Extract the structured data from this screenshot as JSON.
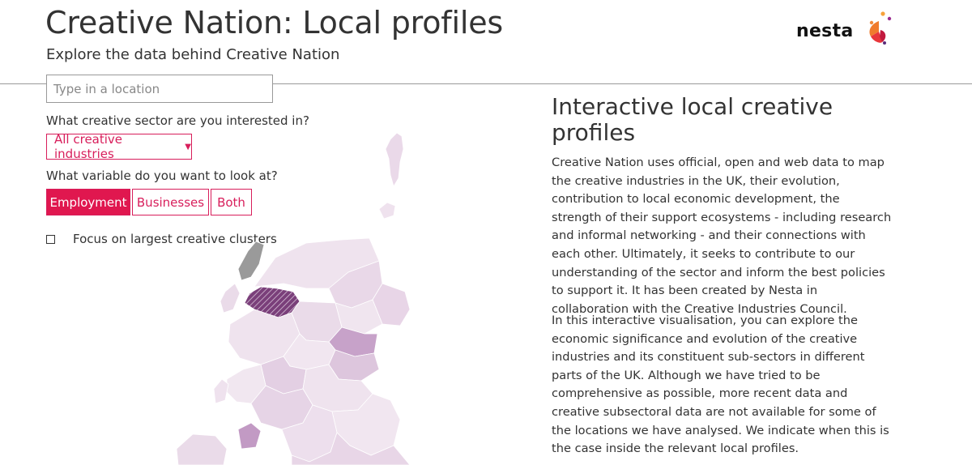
{
  "header": {
    "title": "Creative Nation: Local profiles",
    "subtitle": "Explore the data behind Creative Nation",
    "logo_text": "nesta"
  },
  "search": {
    "placeholder": "Type in a location",
    "value": ""
  },
  "sector": {
    "question": "What creative sector are you interested in?",
    "selected": "All creative industries"
  },
  "variable": {
    "question": "What variable do you want to look at?",
    "options": [
      "Employment",
      "Businesses",
      "Both"
    ],
    "selected": "Employment"
  },
  "focus": {
    "label": "Focus on largest creative clusters",
    "checked": false
  },
  "info": {
    "title": "Interactive local creative profiles",
    "paragraphs": [
      "Creative Nation uses official, open and web data to map the creative industries in the UK, their evolution, contribution to local economic development, the strength of their support ecosystems - including research and informal networking - and their connections with each other. Ultimately, it seeks to contribute to our understanding of the sector and inform the best policies to support it. It has been created by Nesta in collaboration with the Creative Industries Council.",
      "In this interactive visualisation, you can explore the economic significance and evolution of the creative industries and its constituent sub-sectors in different parts of the UK. Although we have tried to be comprehensive as possible, more recent data and creative subsectoral data are not available for some of the locations we have analysed. We indicate when this is the case inside the relevant local profiles."
    ]
  },
  "colors": {
    "accent": "#e0174f",
    "map_light": "#f3e9f2",
    "map_mid": "#ddc6dd",
    "map_dark": "#c7a2c9",
    "map_highlight": "#7a3f7a",
    "map_nodata": "#9a9a9a"
  }
}
